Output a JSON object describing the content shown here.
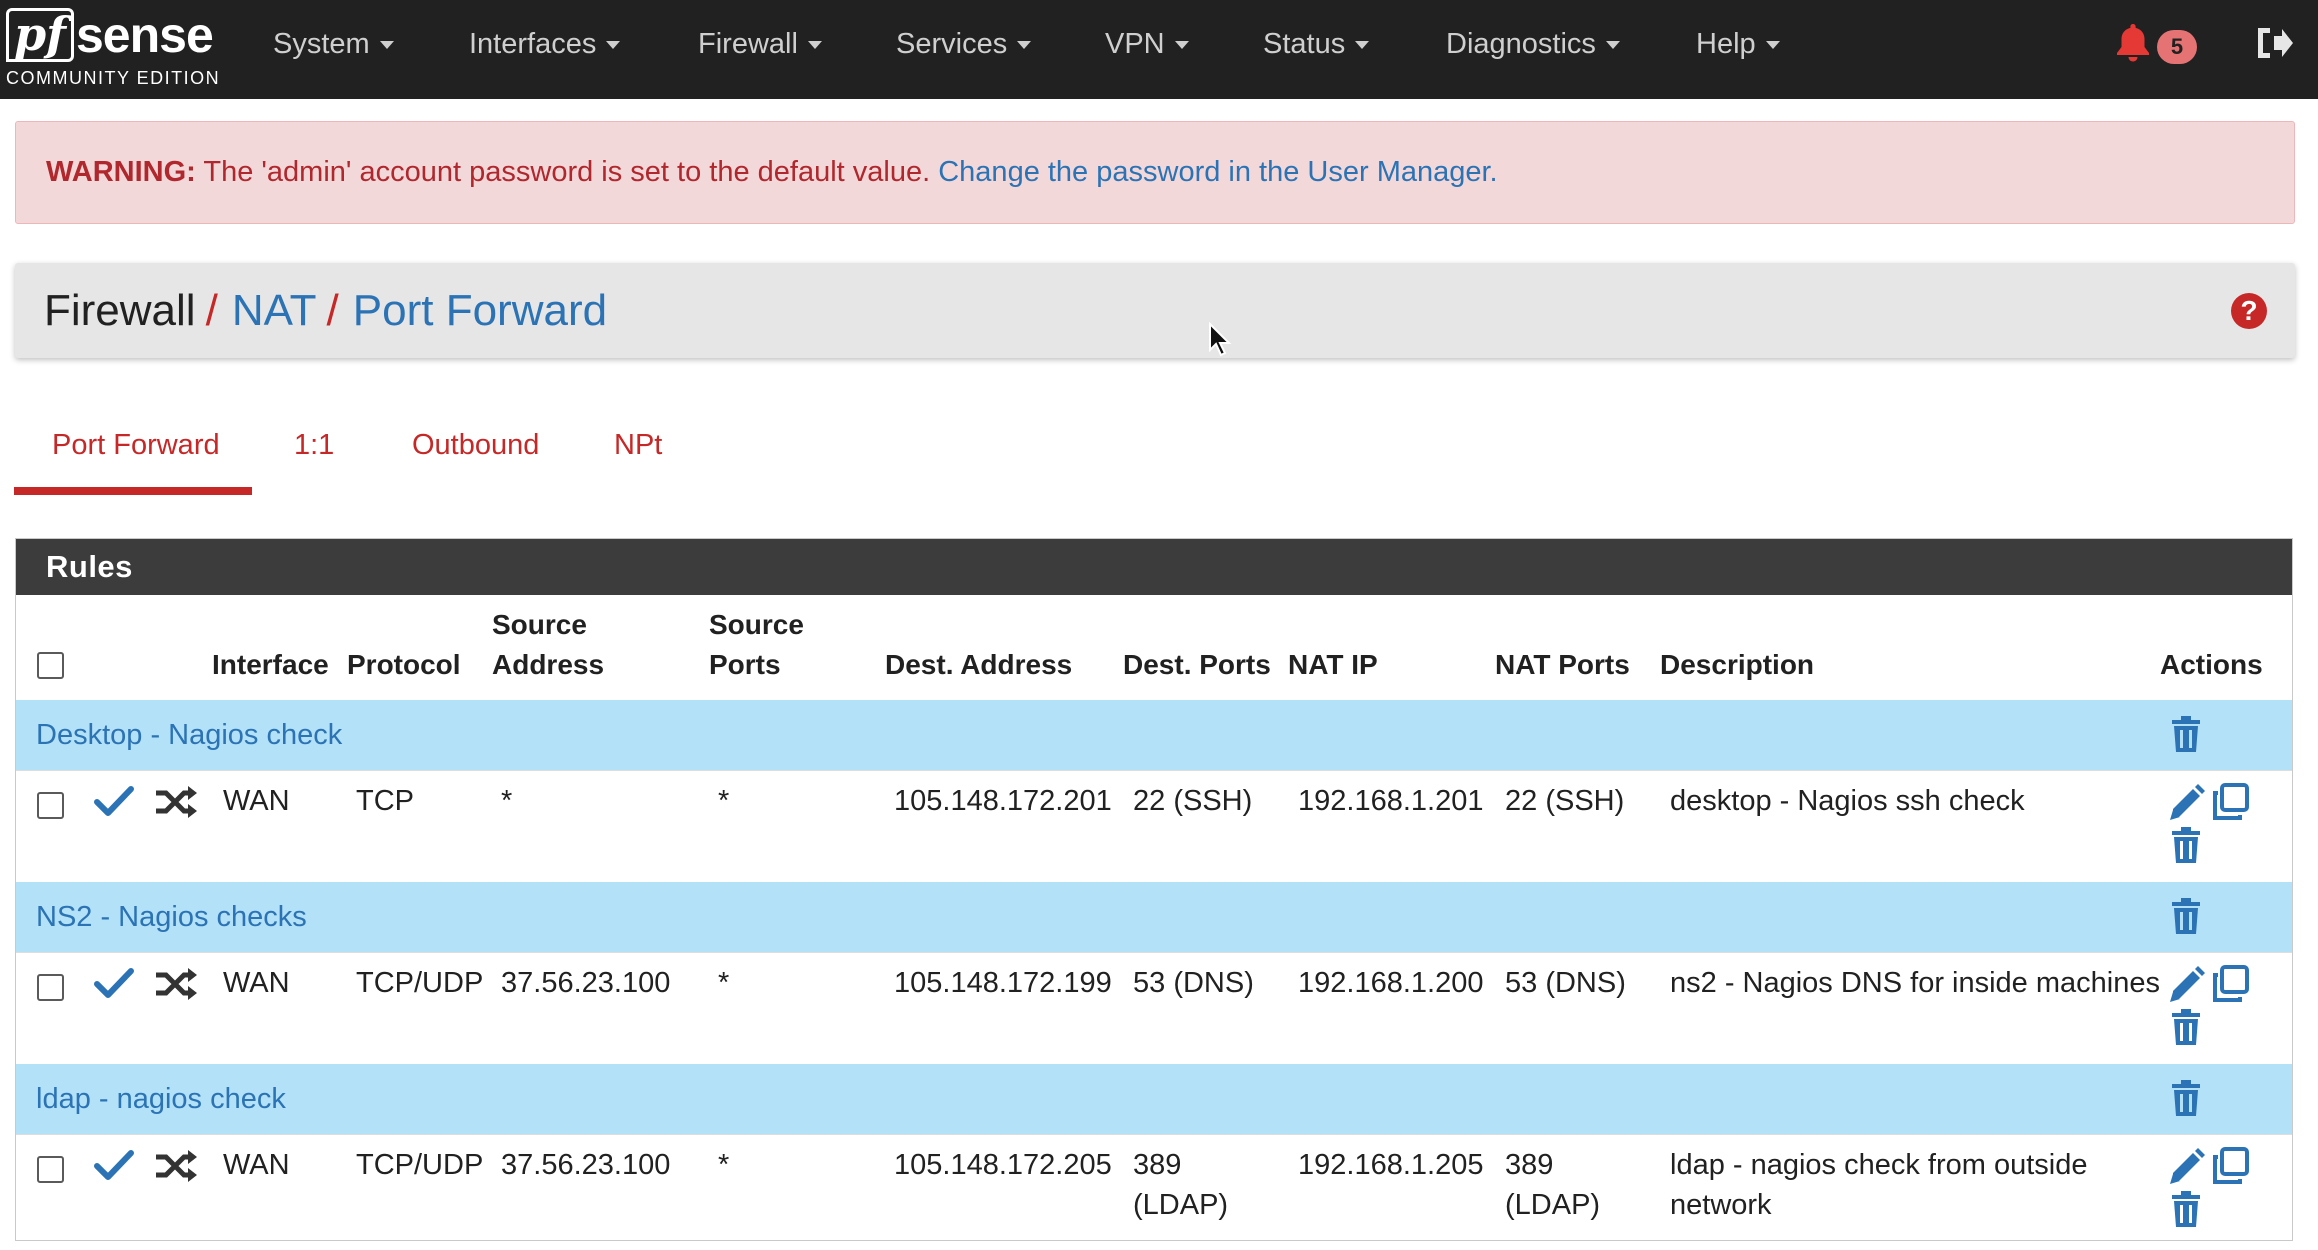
{
  "brand": {
    "pf": "pf",
    "sense": "sense",
    "edition": "COMMUNITY EDITION"
  },
  "nav": {
    "items": [
      "System",
      "Interfaces",
      "Firewall",
      "Services",
      "VPN",
      "Status",
      "Diagnostics",
      "Help"
    ],
    "notification_count": "5"
  },
  "warning": {
    "label": "WARNING:",
    "text": " The 'admin' account password is set to the default value. ",
    "link": "Change the password in the User Manager."
  },
  "breadcrumb": {
    "items": [
      "Firewall",
      "NAT",
      "Port Forward"
    ],
    "separator": "/"
  },
  "tabs": [
    "Port Forward",
    "1:1",
    "Outbound",
    "NPt"
  ],
  "active_tab": "Port Forward",
  "panel": {
    "title": "Rules"
  },
  "table": {
    "headers": {
      "interface": "Interface",
      "protocol": "Protocol",
      "source_address": [
        "Source",
        "Address"
      ],
      "source_ports": [
        "Source",
        "Ports"
      ],
      "dest_address": "Dest. Address",
      "dest_ports": "Dest. Ports",
      "nat_ip": "NAT IP",
      "nat_ports": "NAT Ports",
      "description": "Description",
      "actions": "Actions"
    },
    "groups": [
      {
        "separator": "Desktop - Nagios check",
        "rule": {
          "interface": "WAN",
          "protocol": "TCP",
          "source_address": "*",
          "source_ports": "*",
          "dest_address": "105.148.172.201",
          "dest_ports": [
            "22 (SSH)"
          ],
          "nat_ip": "192.168.1.201",
          "nat_ports": [
            "22 (SSH)"
          ],
          "description": [
            "desktop - Nagios ssh check"
          ]
        }
      },
      {
        "separator": "NS2 - Nagios checks",
        "rule": {
          "interface": "WAN",
          "protocol": "TCP/UDP",
          "source_address": "37.56.23.100",
          "source_ports": "*",
          "dest_address": "105.148.172.199",
          "dest_ports": [
            "53 (DNS)"
          ],
          "nat_ip": "192.168.1.200",
          "nat_ports": [
            "53 (DNS)"
          ],
          "description": [
            "ns2 - Nagios DNS for inside machines"
          ]
        }
      },
      {
        "separator": "ldap - nagios check",
        "rule": {
          "interface": "WAN",
          "protocol": "TCP/UDP",
          "source_address": "37.56.23.100",
          "source_ports": "*",
          "dest_address": "105.148.172.205",
          "dest_ports": [
            "389",
            "(LDAP)"
          ],
          "nat_ip": "192.168.1.205",
          "nat_ports": [
            "389",
            "(LDAP)"
          ],
          "description": [
            "ldap - nagios check from outside",
            "network"
          ]
        }
      }
    ]
  },
  "colors": {
    "navbar": "#212121",
    "accent_red": "#c62828",
    "link_blue": "#2b73b5",
    "separator_row": "#b3e1f7",
    "panel_header": "#3c3c3c",
    "warning_bg": "#f3d8da",
    "check_blue": "#2b73b5"
  }
}
